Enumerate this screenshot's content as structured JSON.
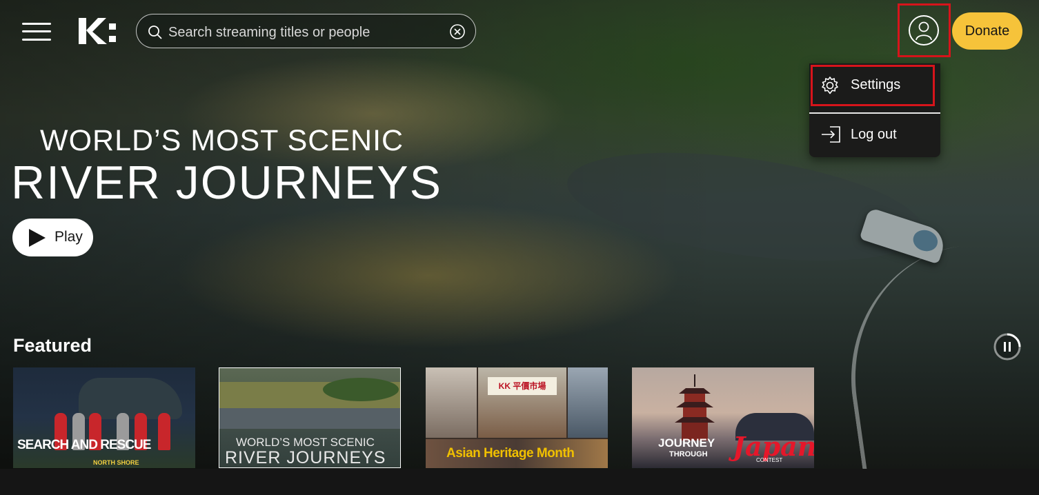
{
  "header": {
    "menu_icon": "hamburger-menu-icon",
    "logo_text": "K:",
    "search": {
      "placeholder": "Search streaming titles or people",
      "value": "",
      "icon": "search-icon",
      "clear_icon": "clear-icon"
    },
    "profile_icon": "user-profile-icon",
    "donate_label": "Donate"
  },
  "profile_menu": {
    "items": [
      {
        "label": "Settings",
        "icon": "gear-icon"
      },
      {
        "label": "Log out",
        "icon": "logout-icon"
      }
    ]
  },
  "hero": {
    "title_line1": "WORLD’S MOST SCENIC",
    "title_line2": "RIVER JOURNEYS",
    "play_label": "Play"
  },
  "featured": {
    "heading": "Featured",
    "cards": [
      {
        "title_main": "SEARCH AND RESCUE",
        "title_sub": "NORTH SHORE"
      },
      {
        "title_main": "WORLD’S MOST SCENIC",
        "title_sub": "RIVER JOURNEYS"
      },
      {
        "title_main": "Asian Heritage Month",
        "sign_text": "KK 平價市場"
      },
      {
        "title_main": "JOURNEY",
        "title_sub": "THROUGH",
        "title_accent": "Japan",
        "title_tag": "CONTEST"
      }
    ]
  },
  "colors": {
    "accent_yellow": "#f6c33a",
    "highlight_red": "#d7141b",
    "background_dark": "#151515"
  }
}
